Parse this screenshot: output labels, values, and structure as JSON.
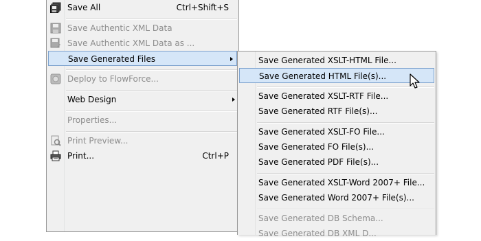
{
  "main_menu": {
    "items": [
      {
        "label": "Save All",
        "shortcut": "Ctrl+Shift+S",
        "icon": "save-all-icon",
        "disabled": false
      },
      {
        "label": "Save Authentic XML Data",
        "icon": "save-xml-icon",
        "disabled": true
      },
      {
        "label": "Save Authentic XML Data as ...",
        "icon": "save-xml-as-icon",
        "disabled": true
      },
      {
        "label": "Save Generated Files",
        "submenu": true,
        "highlighted": true
      },
      {
        "label": "Deploy to FlowForce...",
        "icon": "deploy-icon",
        "disabled": true
      },
      {
        "label": "Web Design",
        "submenu": true
      },
      {
        "label": "Properties...",
        "disabled": true
      },
      {
        "label": "Print Preview...",
        "icon": "print-preview-icon",
        "disabled": true
      },
      {
        "label": "Print...",
        "shortcut": "Ctrl+P",
        "icon": "printer-icon",
        "disabled": false
      }
    ]
  },
  "sub_menu": {
    "items": [
      {
        "label": "Save Generated XSLT-HTML File..."
      },
      {
        "label": "Save Generated HTML File(s)...",
        "highlighted": true
      },
      {
        "label": "Save Generated XSLT-RTF File..."
      },
      {
        "label": "Save Generated RTF File(s)..."
      },
      {
        "label": "Save Generated XSLT-FO File..."
      },
      {
        "label": "Save Generated FO File(s)..."
      },
      {
        "label": "Save Generated PDF File(s)..."
      },
      {
        "label": "Save Generated XSLT-Word 2007+ File..."
      },
      {
        "label": "Save Generated Word 2007+ File(s)..."
      },
      {
        "label": "Save Generated DB Schema...",
        "disabled": true
      },
      {
        "label": "Save Generated DB XML D...",
        "disabled": true
      }
    ]
  },
  "colors": {
    "highlight": "#d5e6f8",
    "highlight_border": "#7da2ce",
    "menu_bg": "#f0f0f0",
    "disabled_text": "#8d8d8d"
  }
}
